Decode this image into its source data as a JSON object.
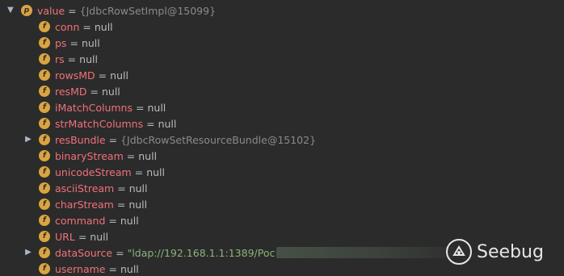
{
  "root": {
    "badge": "p",
    "name": "value",
    "eq": "=",
    "value": "{JdbcRowSetImpl@15099}"
  },
  "fields": [
    {
      "badge": "f",
      "name": "conn",
      "value": "null",
      "kind": "null",
      "expandable": false
    },
    {
      "badge": "f",
      "name": "ps",
      "value": "null",
      "kind": "null",
      "expandable": false
    },
    {
      "badge": "f",
      "name": "rs",
      "value": "null",
      "kind": "null",
      "expandable": false
    },
    {
      "badge": "f",
      "name": "rowsMD",
      "value": "null",
      "kind": "null",
      "expandable": false
    },
    {
      "badge": "f",
      "name": "resMD",
      "value": "null",
      "kind": "null",
      "expandable": false
    },
    {
      "badge": "f",
      "name": "iMatchColumns",
      "value": "null",
      "kind": "null",
      "expandable": false
    },
    {
      "badge": "f",
      "name": "strMatchColumns",
      "value": "null",
      "kind": "null",
      "expandable": false
    },
    {
      "badge": "f",
      "name": "resBundle",
      "value": "{JdbcRowSetResourceBundle@15102}",
      "kind": "obj",
      "expandable": true
    },
    {
      "badge": "f",
      "name": "binaryStream",
      "value": "null",
      "kind": "null",
      "expandable": false
    },
    {
      "badge": "f",
      "name": "unicodeStream",
      "value": "null",
      "kind": "null",
      "expandable": false
    },
    {
      "badge": "f",
      "name": "asciiStream",
      "value": "null",
      "kind": "null",
      "expandable": false
    },
    {
      "badge": "f",
      "name": "charStream",
      "value": "null",
      "kind": "null",
      "expandable": false
    },
    {
      "badge": "f",
      "name": "command",
      "value": "null",
      "kind": "null",
      "expandable": false
    },
    {
      "badge": "f",
      "name": "URL",
      "value": "null",
      "kind": "null",
      "expandable": false
    },
    {
      "badge": "f",
      "name": "dataSource",
      "value": "\"ldap://192.168.1.1:1389/Poc",
      "kind": "str",
      "expandable": true
    },
    {
      "badge": "f",
      "name": "username",
      "value": "null",
      "kind": "null",
      "expandable": false
    }
  ],
  "equals": "=",
  "watermark": {
    "text": "Seebug"
  },
  "colors": {
    "background": "#2b2b2b",
    "field_name": "#f07178",
    "badge": "#d9a441",
    "string_value": "#8ab47b",
    "object_value": "#8a8a8a"
  },
  "icons": {
    "expand": "chevron-right-icon",
    "field": "field-icon",
    "root": "property-icon"
  }
}
